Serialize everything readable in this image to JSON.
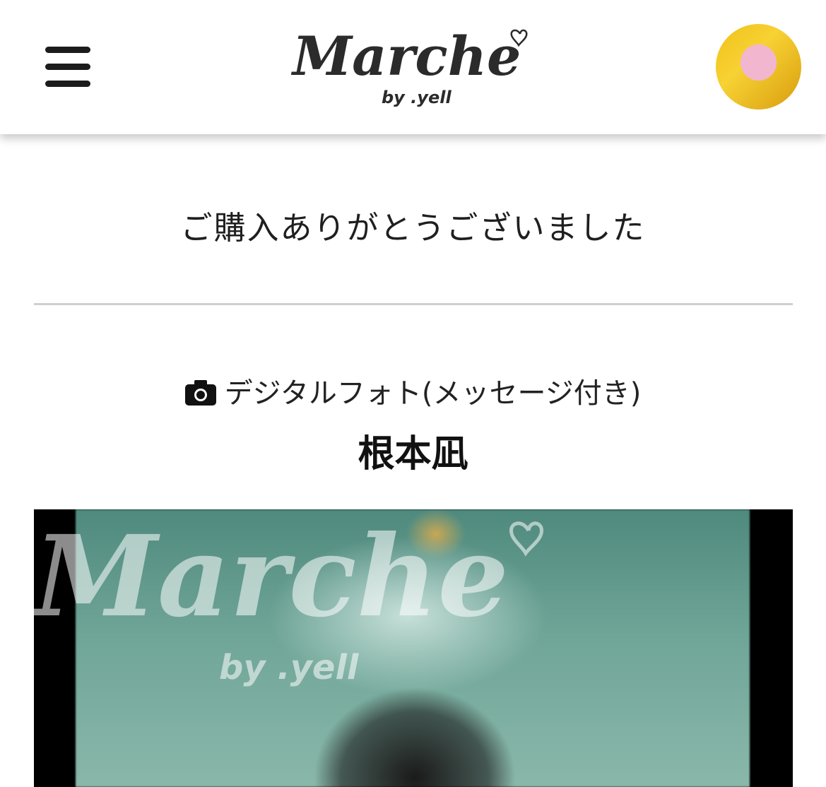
{
  "header": {
    "menu_icon": "hamburger-menu-icon",
    "logo": {
      "title": "Marche",
      "byline": "by .yell"
    },
    "avatar_icon": "user-avatar"
  },
  "main": {
    "thanks_message": "ご購入ありがとうございました",
    "product": {
      "type_icon": "camera-icon",
      "type_label": "デジタルフォト(メッセージ付き)",
      "name": "根本凪"
    },
    "photo": {
      "watermark_title": "Marche",
      "watermark_byline": "by .yell"
    }
  },
  "colors": {
    "text": "#1f1f1f",
    "divider": "#cfcfcf",
    "photo_background": "#000000"
  }
}
